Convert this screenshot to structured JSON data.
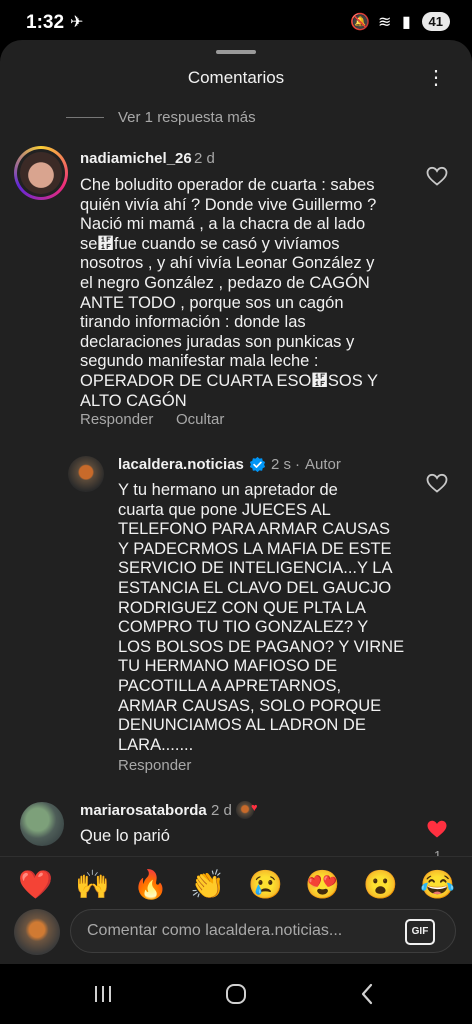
{
  "status": {
    "time": "1:32",
    "battery": "41"
  },
  "sheet": {
    "title": "Comentarios"
  },
  "view_more_replies": "Ver 1 respuesta más",
  "comments": [
    {
      "username": "nadiamichel_26",
      "time": "2 d",
      "text": "Che boludito operador de cuarta : sabes\nquién vivía ahí ? Donde vive Guillermo ?\nNació mi mamá , a la chacra de al lado\nse἟fue cuando se casó y vivíamos\nnosotros , y ahí vivía Leonar González y\nel negro González , pedazo de CAGÓN\nANTE TODO , porque sos un cagón\ntirando información : donde las\ndeclaraciones juradas son punkicas y\nsegundo manifestar mala leche :\nOPERADOR DE CUARTA ESO἟SOS Y\nALTO CAGÓN",
      "reply_label": "Responder",
      "hide_label": "Ocultar"
    },
    {
      "username": "lacaldera.noticias",
      "time": "2 s",
      "author_label": "Autor",
      "text": "Y tu hermano un apretador de\ncuarta que pone JUECES AL\nTELEFONO PARA ARMAR CAUSAS\nY PADECRMOS LA MAFIA DE ESTE\nSERVICIO DE INTELIGENCIA...Y LA\nESTANCIA EL CLAVO DEL GAUCJO\nRODRIGUEZ CON QUE PLTA LA\nCOMPRO TU TIO GONZALEZ? Y\nLOS BOLSOS DE PAGANO? Y VIRNE\nTU HERMANO MAFIOSO DE\nPACOTILLA A APRETARNOS,\nARMAR CAUSAS, SOLO PORQUE\nDENUNCIAMOS AL LADRON DE\nLARA.......",
      "reply_label": "Responder"
    },
    {
      "username": "mariarosataborda",
      "time": "2 d",
      "text": "Que lo parió",
      "like_count": "1"
    }
  ],
  "emoji_bar": [
    "❤️",
    "🙌",
    "🔥",
    "👏",
    "😢",
    "😍",
    "😮",
    "😂"
  ],
  "composer": {
    "placeholder": "Comentar como lacaldera.noticias...",
    "gif_label": "GIF"
  },
  "colors": {
    "sheet_bg": "#212121",
    "liked_red": "#ff3040",
    "verified_blue": "#0095f6",
    "meta_gray": "#a8a8a8"
  }
}
